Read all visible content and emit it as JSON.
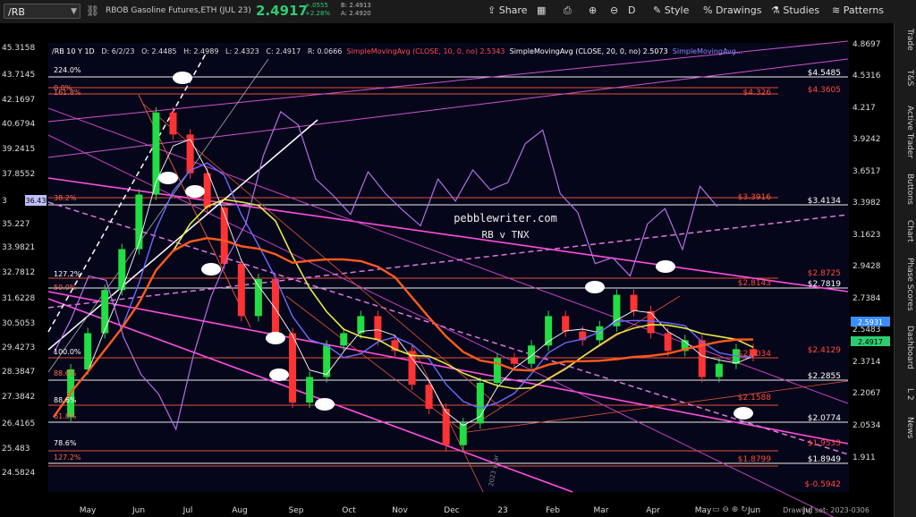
{
  "toolbar": {
    "symbol": "/RB",
    "description": "RBOB Gasoline Futures,ETH (JUL 23)",
    "last_price": "2.4917",
    "change": "+.0555",
    "change_pct": "+2.28%",
    "bid": "B: 2.4913",
    "ask": "A: 2.4920",
    "share_label": "Share",
    "timeframe": "D",
    "style_label": "Style",
    "drawings_label": "Drawings",
    "studies_label": "Studies",
    "patterns_label": "Patterns"
  },
  "stats": {
    "title": "/RB 10 Y 1D",
    "date": "D: 6/2/23",
    "open": "O: 2.4485",
    "high": "H: 2.4989",
    "low": "L: 2.4323",
    "close": "C: 2.4917",
    "range": "R: 0.0666",
    "sma10": "SimpleMovingAvg (CLOSE, 10, 0, no)",
    "sma10_val": "2.5343",
    "sma20": "SimpleMovingAvg (CLOSE, 20, 0, no)",
    "sma20_val": "2.5073",
    "sma_more": "SimpleMovingAvg"
  },
  "sidebar_tabs": [
    "Trade",
    "T&S",
    "Active Trader",
    "Buttons",
    "Chart",
    "Phase Scores",
    "Dashboard",
    "L 2",
    "News"
  ],
  "drawing_set": "Drawing set: 2023-0306",
  "chart_data": {
    "type": "line",
    "title": "pebblewriter.com",
    "subtitle": "RB v TNX",
    "x_labels": [
      "May",
      "Jun",
      "Jul",
      "Aug",
      "Sep",
      "Oct",
      "Nov",
      "Dec",
      "23",
      "Feb",
      "Mar",
      "Apr",
      "May",
      "Jun",
      "Jul"
    ],
    "left_ticks": [
      "45.3158",
      "43.7145",
      "42.1697",
      "40.6794",
      "39.2415",
      "37.8552",
      "36.43",
      "35.227",
      "33.9821",
      "32.7812",
      "31.6228",
      "30.5053",
      "29.4273",
      "28.3847",
      "27.3842",
      "26.4165",
      "25.483",
      "24.5824"
    ],
    "right_ticks": [
      "4.8697",
      "4.5316",
      "4.217",
      "3.9242",
      "3.6517",
      "3.3982",
      "3.1623",
      "2.9428",
      "2.7384",
      "2.5483",
      "2.3714",
      "2.2067",
      "2.0534",
      "1.911"
    ],
    "right_level_labels_white": [
      "$4.5485",
      "$3.4134",
      "$2.7819",
      "$2.2855",
      "$2.0774",
      "$1.8949"
    ],
    "right_level_labels_red": [
      "$4.3605",
      "$4.326",
      "$3.3916",
      "$2.8725",
      "$2.8143",
      "$2.4129",
      "$2.4034",
      "$2.1588",
      "$1.9533",
      "$1.8799",
      "$-0.5942"
    ],
    "left_level_labels": [
      "224.0%",
      "0.0%",
      "161.8%",
      "38.2%",
      "127.2%",
      "50.0%",
      "100.0%",
      "88.6%",
      "88.6%",
      "61.8%",
      "78.6%",
      "127.2%"
    ],
    "current_price_tags": [
      "2.5931",
      "2.4917"
    ],
    "left_price_tag": "36.43",
    "annotation": "2023 year",
    "ylim_right": [
      1.85,
      4.95
    ],
    "series": [
      {
        "name": "RB",
        "values": [
          2.18,
          2.42,
          2.62,
          2.88,
          3.15,
          3.55,
          4.25,
          4.05,
          3.72,
          3.45,
          3.05,
          2.72,
          2.95,
          2.62,
          2.25,
          2.38,
          2.55,
          2.62,
          2.72,
          2.58,
          2.52,
          2.34,
          2.22,
          2.05,
          2.15,
          2.35,
          2.48,
          2.45,
          2.55,
          2.72,
          2.63,
          2.58,
          2.66,
          2.85,
          2.75,
          2.62,
          2.52,
          2.58,
          2.38,
          2.45,
          2.53,
          2.4917
        ]
      },
      {
        "name": "TNX",
        "values": [
          29.7,
          31.2,
          33.2,
          33.0,
          30.4,
          28.8,
          28.0,
          26.6,
          29.6,
          32.2,
          34.2,
          35.8,
          39.5,
          42.1,
          41.3,
          38.2,
          37.3,
          36.3,
          38.6,
          37.4,
          36.5,
          35.7,
          38.2,
          37.0,
          38.7,
          37.6,
          38.0,
          40.2,
          41.0,
          37.4,
          36.4,
          33.8,
          34.1,
          33.2,
          35.8,
          36.6,
          34.5,
          37.8,
          36.7
        ]
      }
    ]
  }
}
